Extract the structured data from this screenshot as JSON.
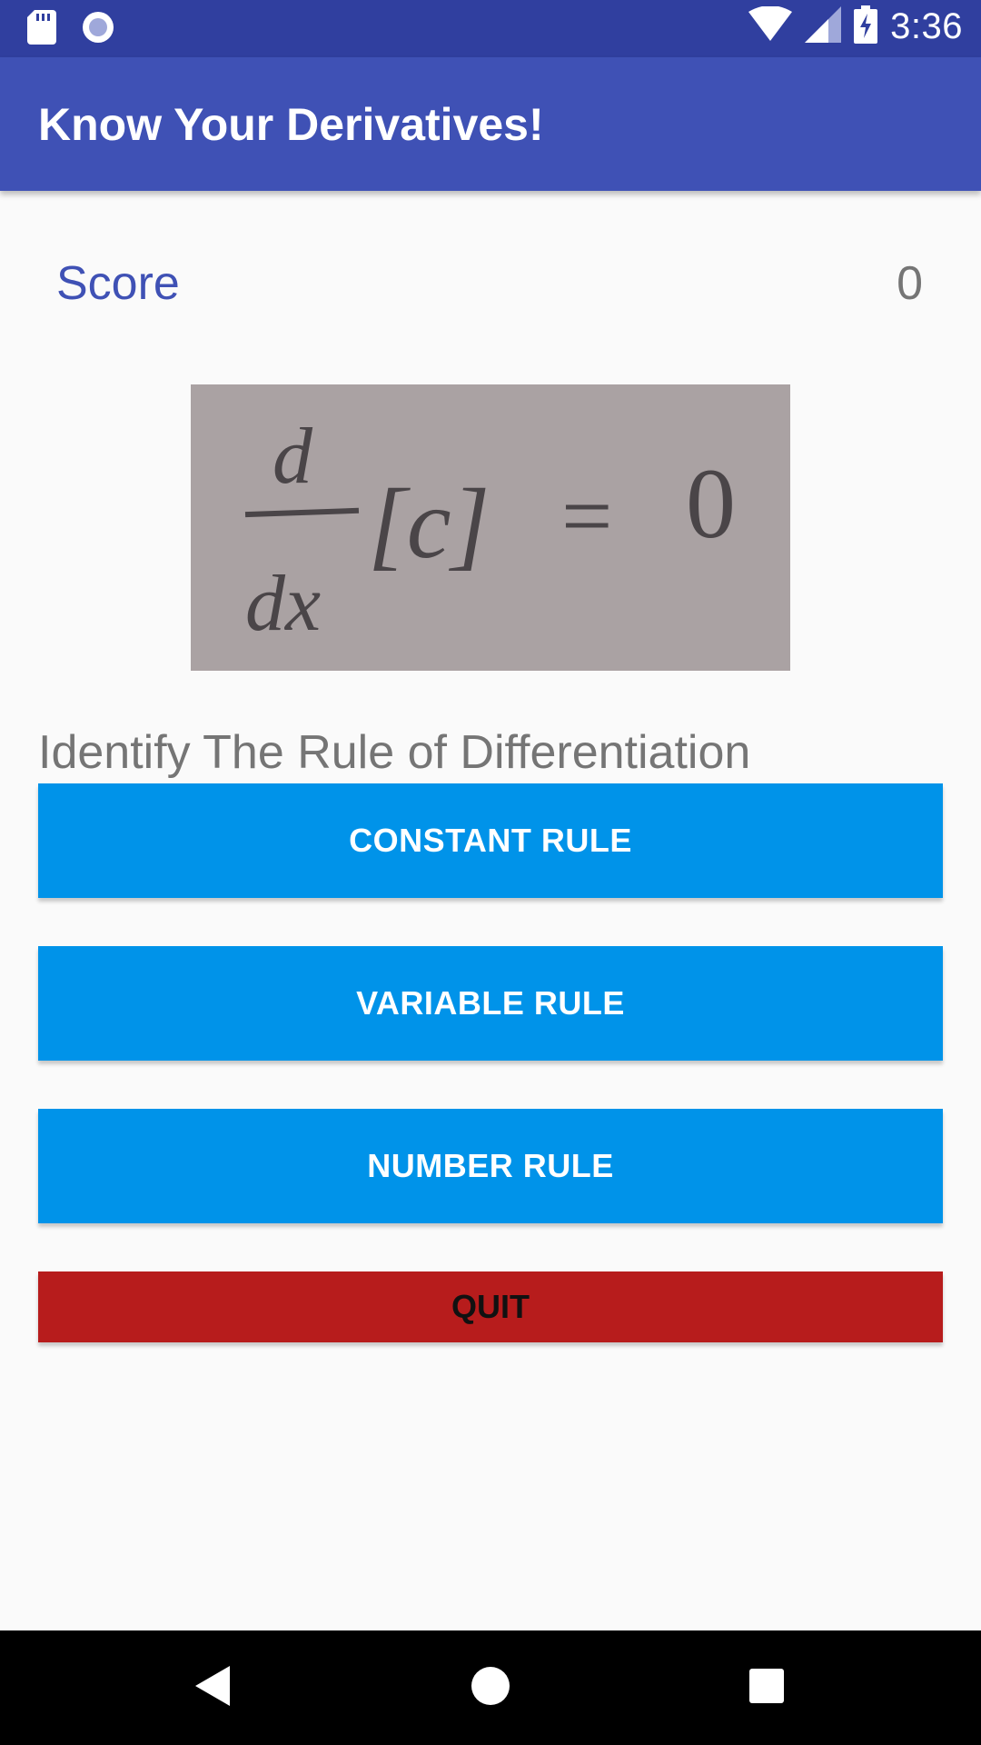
{
  "status_bar": {
    "time": "3:36",
    "icons": [
      "sd-card-icon",
      "cast-icon",
      "wifi-icon",
      "signal-icon",
      "battery-charging-icon"
    ]
  },
  "app_bar": {
    "title": "Know Your Derivatives!"
  },
  "score": {
    "label": "Score",
    "value": "0"
  },
  "formula_image": {
    "numerator": "d",
    "denominator": "dx",
    "expression": "[c]",
    "equals": "=",
    "result": "0"
  },
  "question": "Identify The Rule of Differentiation",
  "answers": [
    {
      "label": "CONSTANT RULE"
    },
    {
      "label": "VARIABLE RULE"
    },
    {
      "label": "NUMBER RULE"
    }
  ],
  "quit_label": "QUIT",
  "nav_bar": {
    "icons": [
      "back-icon",
      "home-icon",
      "recents-icon"
    ]
  },
  "colors": {
    "status_bar": "#303f9f",
    "app_bar": "#3f51b5",
    "answer_button": "#0093e9",
    "quit_button": "#b71c1c"
  }
}
